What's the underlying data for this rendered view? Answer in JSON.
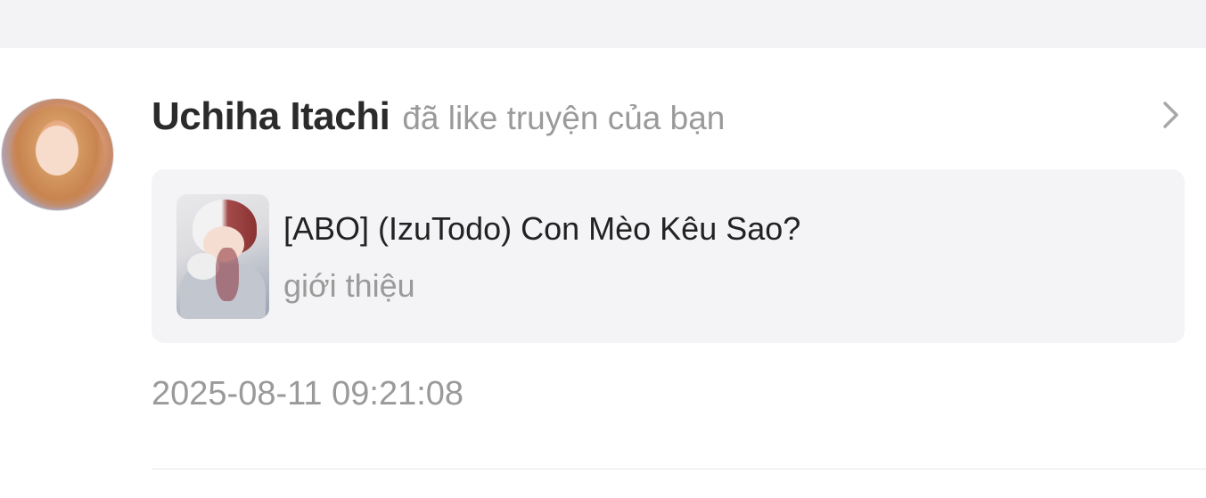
{
  "notification": {
    "user_name": "Uchiha Itachi",
    "action_text": "đã like truyện của bạn",
    "avatar_icon": "user-avatar",
    "chevron_icon": "chevron-right-icon",
    "story": {
      "title": "[ABO] (IzuTodo) Con Mèo Kêu Sao?",
      "subtitle": "giới thiệu",
      "cover_icon": "story-cover-image"
    },
    "timestamp": "2025-08-11 09:21:08"
  },
  "colors": {
    "page_background": "#ffffff",
    "top_band": "#f3f3f5",
    "card_background": "#f4f4f6",
    "primary_text": "#2b2b2b",
    "secondary_text": "#9a9a9a",
    "divider": "#e6e6e6"
  }
}
